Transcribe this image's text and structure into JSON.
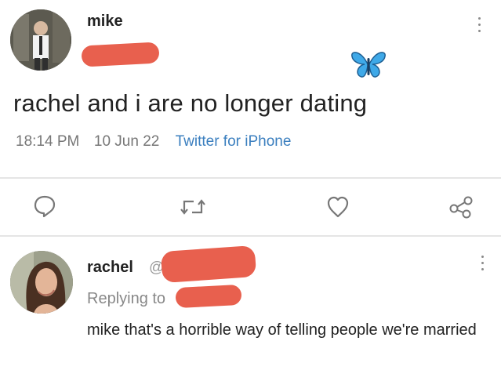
{
  "tweet": {
    "author_name": "mike",
    "text": "rachel and i are no longer dating",
    "time": "18:14 PM",
    "date": "10 Jun 22",
    "source": "Twitter for iPhone",
    "emoji_icon": "butterfly-icon"
  },
  "actions": [
    {
      "name": "reply",
      "icon": "reply-icon"
    },
    {
      "name": "retweet",
      "icon": "retweet-icon"
    },
    {
      "name": "like",
      "icon": "heart-icon"
    },
    {
      "name": "share",
      "icon": "share-icon"
    }
  ],
  "reply": {
    "author_name": "rachel",
    "handle_visible": "@",
    "replying_label": "Replying to",
    "text": "mike that's a horrible way of telling people we're married"
  },
  "colors": {
    "redaction": "#e8604e",
    "source_link": "#3b7fbf",
    "butterfly": "#3fa9e8",
    "meta_gray": "#777777"
  }
}
